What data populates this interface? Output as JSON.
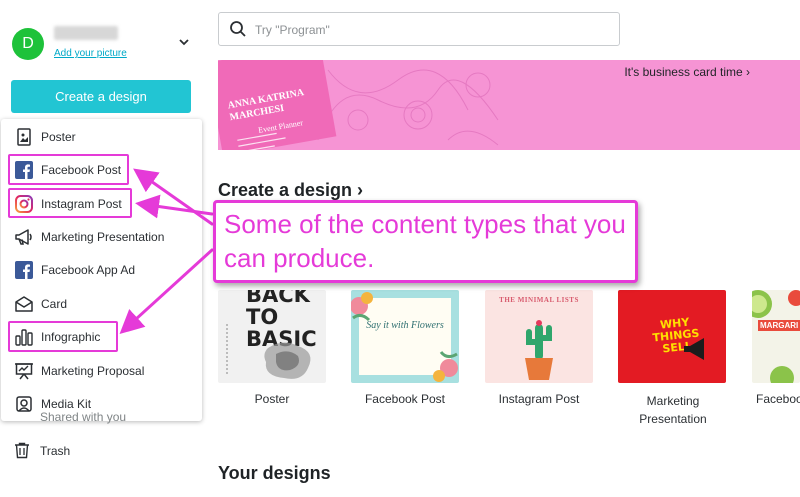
{
  "sidebar": {
    "avatar_letter": "D",
    "add_picture": "Add your picture",
    "create_button": "Create a design",
    "menu_items": [
      {
        "label": "Poster",
        "icon": "poster-icon"
      },
      {
        "label": "Facebook Post",
        "icon": "facebook-icon"
      },
      {
        "label": "Instagram Post",
        "icon": "instagram-icon"
      },
      {
        "label": "Marketing Presentation",
        "icon": "megaphone-icon"
      },
      {
        "label": "Facebook App Ad",
        "icon": "facebook-icon"
      },
      {
        "label": "Card",
        "icon": "envelope-icon"
      },
      {
        "label": "Infographic",
        "icon": "bar-chart-icon"
      },
      {
        "label": "Marketing Proposal",
        "icon": "presentation-board-icon"
      },
      {
        "label": "Media Kit",
        "icon": "camera-icon"
      }
    ],
    "ghost_item": "Shared with you",
    "trash": "Trash"
  },
  "search": {
    "placeholder": "Try \"Program\""
  },
  "banner": {
    "card_name": "ANNA KATRINA MARCHESI",
    "card_role": "Event Planner",
    "link": "It's business card time ›"
  },
  "create_section": {
    "title": "Create a design ›",
    "designs": [
      {
        "label": "Poster",
        "thumb_text": "BACK TO BASIC"
      },
      {
        "label": "Facebook Post",
        "thumb_text": "Say it with Flowers"
      },
      {
        "label": "Instagram Post",
        "thumb_text": "THE MINIMAL LISTS"
      },
      {
        "label": "Marketing Presentation",
        "thumb_text": "WHY THINGS SELL"
      },
      {
        "label": "Faceboo",
        "thumb_text": "MARGARI"
      }
    ]
  },
  "your_designs": "Your designs",
  "annotation": {
    "text": "Some of the content types that you can produce.",
    "color": "#e53ad8"
  },
  "colors": {
    "accent": "#22c5d3",
    "avatar": "#1ec23a",
    "banner": "#f694d4",
    "highlight": "#e53ad8"
  }
}
